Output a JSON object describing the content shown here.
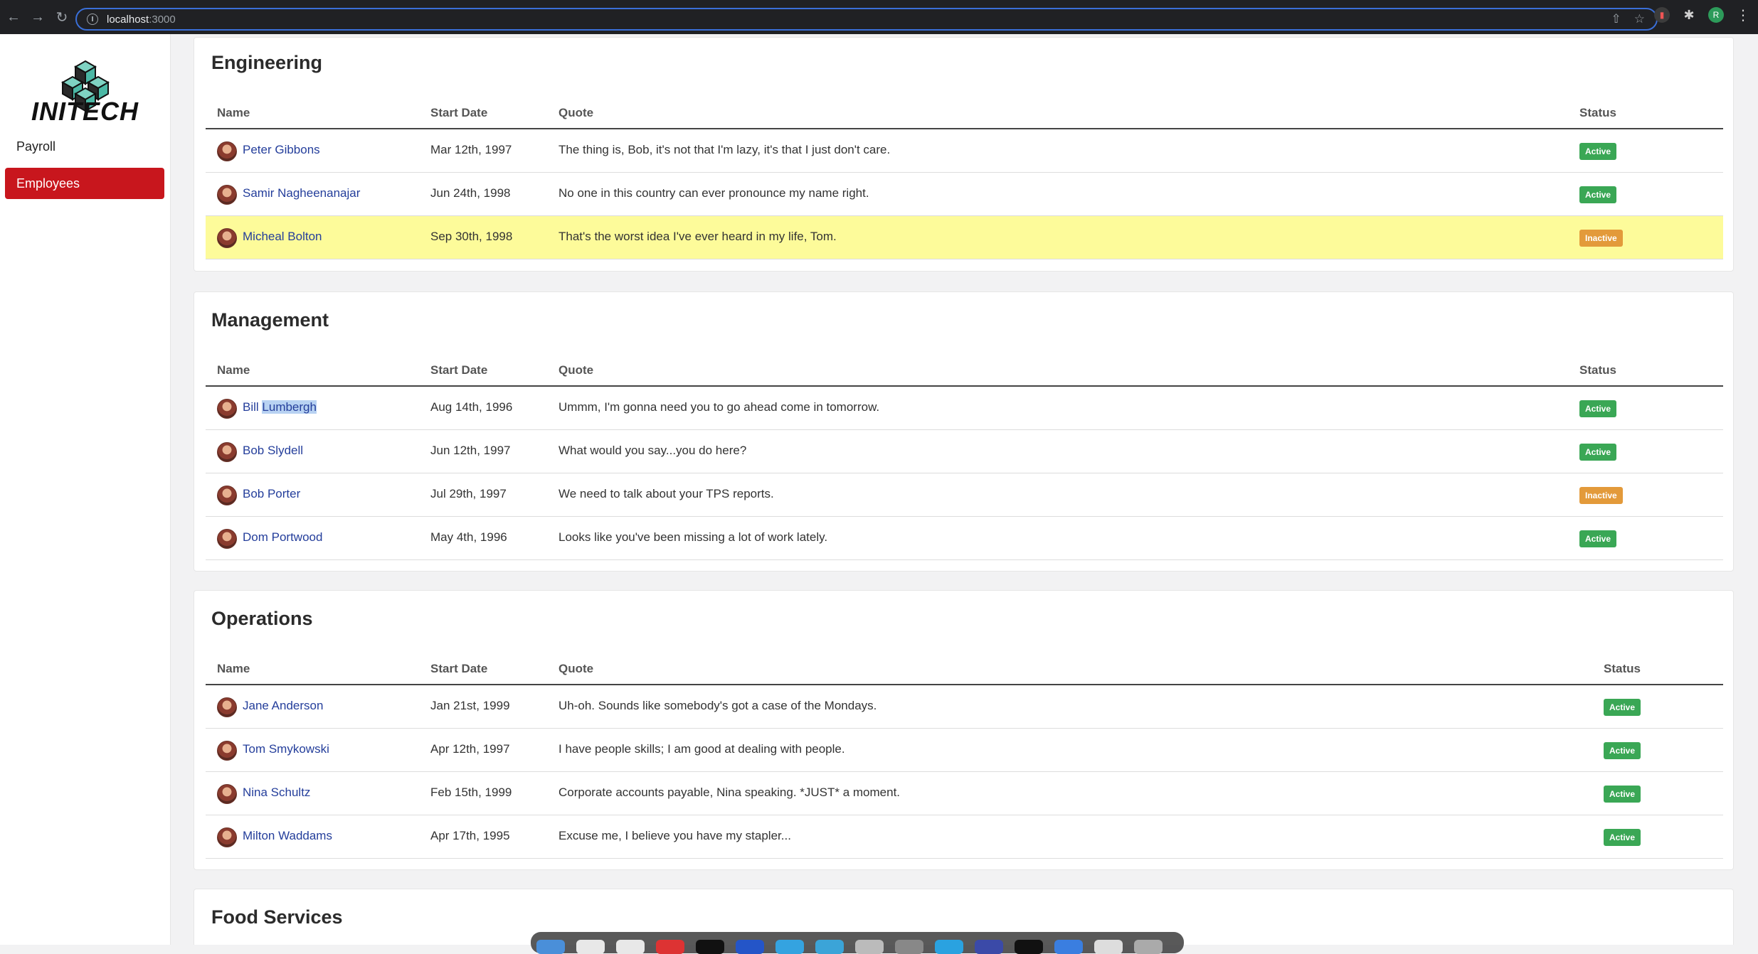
{
  "browser": {
    "url_host": "localhost",
    "url_port": ":3000"
  },
  "sidebar": {
    "logo_text": "INITECH",
    "items": [
      {
        "label": "Payroll",
        "active": false
      },
      {
        "label": "Employees",
        "active": true
      }
    ]
  },
  "columns": {
    "name": "Name",
    "start_date": "Start Date",
    "quote": "Quote",
    "status": "Status"
  },
  "sections": [
    {
      "title": "Engineering",
      "rows": [
        {
          "name": "Peter Gibbons",
          "start_date": "Mar 12th, 1997",
          "quote": "The thing is, Bob, it's not that I'm lazy, it's that I just don't care.",
          "status": "Active"
        },
        {
          "name": "Samir Nagheenanajar",
          "start_date": "Jun 24th, 1998",
          "quote": "No one in this country can ever pronounce my name right.",
          "status": "Active"
        },
        {
          "name": "Micheal Bolton",
          "start_date": "Sep 30th, 1998",
          "quote": "That's the worst idea I've ever heard in my life, Tom.",
          "status": "Inactive"
        }
      ]
    },
    {
      "title": "Management",
      "rows": [
        {
          "name": "Bill Lumbergh",
          "name_first": "Bill",
          "name_last": "Lumbergh",
          "start_date": "Aug 14th, 1996",
          "quote": "Ummm, I'm gonna need you to go ahead come in tomorrow.",
          "status": "Active"
        },
        {
          "name": "Bob Slydell",
          "start_date": "Jun 12th, 1997",
          "quote": "What would you say...you do here?",
          "status": "Active"
        },
        {
          "name": "Bob Porter",
          "start_date": "Jul 29th, 1997",
          "quote": "We need to talk about your TPS reports.",
          "status": "Inactive"
        },
        {
          "name": "Dom Portwood",
          "start_date": "May 4th, 1996",
          "quote": "Looks like you've been missing a lot of work lately.",
          "status": "Active"
        }
      ]
    },
    {
      "title": "Operations",
      "rows": [
        {
          "name": "Jane Anderson",
          "start_date": "Jan 21st, 1999",
          "quote": "Uh-oh. Sounds like somebody's got a case of the Mondays.",
          "status": "Active"
        },
        {
          "name": "Tom Smykowski",
          "start_date": "Apr 12th, 1997",
          "quote": "I have people skills; I am good at dealing with people.",
          "status": "Active"
        },
        {
          "name": "Nina Schultz",
          "start_date": "Feb 15th, 1999",
          "quote": "Corporate accounts payable, Nina speaking. *JUST* a moment.",
          "status": "Active"
        },
        {
          "name": "Milton Waddams",
          "start_date": "Apr 17th, 1995",
          "quote": "Excuse me, I believe you have my stapler...",
          "status": "Active"
        }
      ]
    },
    {
      "title": "Food Services",
      "rows": []
    }
  ],
  "colors": {
    "active": "#3aa755",
    "inactive": "#e39a3a",
    "nav_active": "#c8161d",
    "highlight": "#fdfb9a",
    "link": "#243e9b"
  }
}
